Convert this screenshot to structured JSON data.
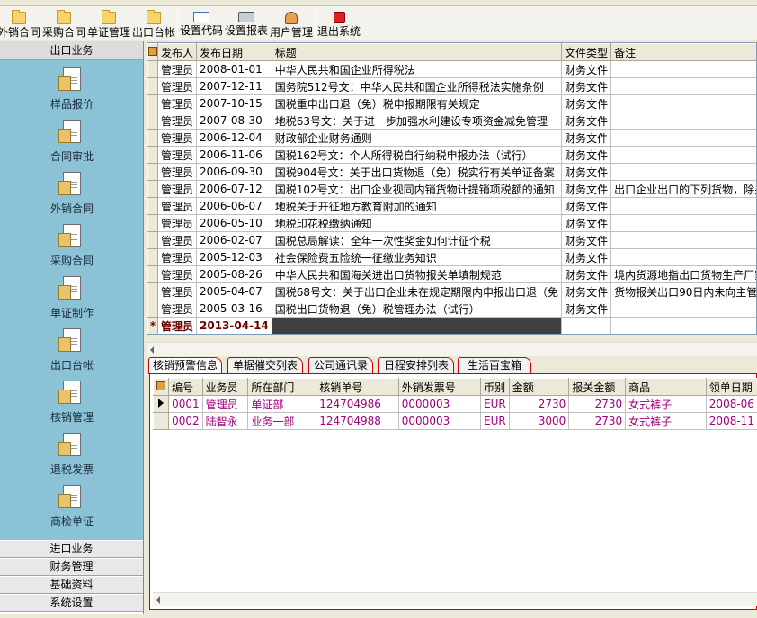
{
  "toolbar": {
    "buttons": [
      "外销合同",
      "采购合同",
      "单证管理",
      "出口台帐",
      "设置代码",
      "设置报表",
      "用户管理",
      "退出系统"
    ]
  },
  "sidebar": {
    "header": "出口业务",
    "items": [
      "样品报价",
      "合同审批",
      "外销合同",
      "采购合同",
      "单证制作",
      "出口台帐",
      "核销管理",
      "退税发票",
      "商检单证"
    ],
    "footer": [
      "进口业务",
      "财务管理",
      "基础资料",
      "系统设置"
    ]
  },
  "docs": {
    "columns": [
      "发布人",
      "发布日期",
      "标题",
      "文件类型",
      "备注"
    ],
    "rows": [
      [
        "管理员",
        "2008-01-01",
        "中华人民共和国企业所得税法",
        "财务文件",
        ""
      ],
      [
        "管理员",
        "2007-12-11",
        "国务院512号文：中华人民共和国企业所得税法实施条例",
        "财务文件",
        ""
      ],
      [
        "管理员",
        "2007-10-15",
        "国税重申出口退（免）税申报期限有关规定",
        "财务文件",
        ""
      ],
      [
        "管理员",
        "2007-08-30",
        "地税63号文：关于进一步加强水利建设专项资金减免管理",
        "财务文件",
        ""
      ],
      [
        "管理员",
        "2006-12-04",
        "财政部企业财务通则",
        "财务文件",
        ""
      ],
      [
        "管理员",
        "2006-11-06",
        "国税162号文：个人所得税自行纳税申报办法（试行）",
        "财务文件",
        ""
      ],
      [
        "管理员",
        "2006-09-30",
        "国税904号文：关于出口货物退（免）税实行有关单证备案",
        "财务文件",
        ""
      ],
      [
        "管理员",
        "2006-07-12",
        "国税102号文：出口企业视同内销货物计提销项税额的通知",
        "财务文件",
        "出口企业出口的下列货物，除另"
      ],
      [
        "管理员",
        "2006-06-07",
        "地税关于开征地方教育附加的通知",
        "财务文件",
        ""
      ],
      [
        "管理员",
        "2006-05-10",
        "地税印花税缴纳通知",
        "财务文件",
        ""
      ],
      [
        "管理员",
        "2006-02-07",
        "国税总局解读：全年一次性奖金如何计征个税",
        "财务文件",
        ""
      ],
      [
        "管理员",
        "2005-12-03",
        "社会保险费五险统一征缴业务知识",
        "财务文件",
        ""
      ],
      [
        "管理员",
        "2005-08-26",
        "中华人民共和国海关进出口货物报关单填制规范",
        "财务文件",
        "境内货源地指出口货物生产厂家"
      ],
      [
        "管理员",
        "2005-04-07",
        "国税68号文：关于出口企业未在规定期限内申报出口退（免",
        "财务文件",
        "货物报关出口90日内未向主管税"
      ],
      [
        "管理员",
        "2005-03-16",
        "国税出口货物退（免）税管理办法（试行）",
        "财务文件",
        ""
      ]
    ],
    "new_row": {
      "marker": "*",
      "publisher": "管理员",
      "date": "2013-04-14"
    }
  },
  "tabs": [
    "核销预警信息",
    "单据催交列表",
    "公司通讯录",
    "日程安排列表",
    "生活百宝箱"
  ],
  "alerts": {
    "columns": [
      "编号",
      "业务员",
      "所在部门",
      "核销单号",
      "外销发票号",
      "币别",
      "金额",
      "报关金额",
      "商品",
      "领单日期"
    ],
    "rows": [
      [
        "0001",
        "管理员",
        "单证部",
        "124704986",
        "0000003",
        "EUR",
        "2730",
        "2730",
        "女式裤子",
        "2008-06"
      ],
      [
        "0002",
        "陆智永",
        "业务一部",
        "124704988",
        "0000003",
        "EUR",
        "3000",
        "2730",
        "女式裤子",
        "2008-11"
      ]
    ]
  }
}
